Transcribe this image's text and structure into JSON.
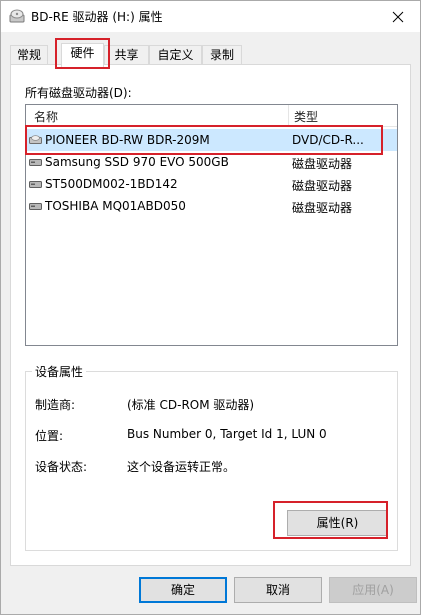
{
  "window": {
    "title": "BD-RE 驱动器 (H:) 属性",
    "title_icon": "optical-drive-icon",
    "close_icon": "close-icon"
  },
  "tabs": [
    {
      "label": "常规",
      "active": false
    },
    {
      "label": "硬件",
      "active": true
    },
    {
      "label": "共享",
      "active": false
    },
    {
      "label": "自定义",
      "active": false
    },
    {
      "label": "录制",
      "active": false
    }
  ],
  "hardware": {
    "list_caption": "所有磁盘驱动器(D):",
    "columns": {
      "name": "名称",
      "type": "类型"
    },
    "devices": [
      {
        "name": "PIONEER BD-RW   BDR-209M",
        "type": "DVD/CD-R...",
        "selected": true,
        "icon": "optical-drive-icon"
      },
      {
        "name": "Samsung SSD 970 EVO 500GB",
        "type": "磁盘驱动器",
        "selected": false,
        "icon": "disk-drive-icon"
      },
      {
        "name": "ST500DM002-1BD142",
        "type": "磁盘驱动器",
        "selected": false,
        "icon": "disk-drive-icon"
      },
      {
        "name": "TOSHIBA MQ01ABD050",
        "type": "磁盘驱动器",
        "selected": false,
        "icon": "disk-drive-icon"
      }
    ],
    "device_properties": {
      "title": "设备属性",
      "manufacturer_label": "制造商:",
      "manufacturer_value": "(标准 CD-ROM 驱动器)",
      "location_label": "位置:",
      "location_value": "Bus Number 0, Target Id 1, LUN 0",
      "status_label": "设备状态:",
      "status_value": "这个设备运转正常。",
      "properties_button": "属性(R)"
    }
  },
  "footer": {
    "ok": "确定",
    "cancel": "取消",
    "apply": "应用(A)"
  },
  "colors": {
    "highlight_red": "#d6212a",
    "selection": "#cce8ff",
    "default_button_border": "#0078d7"
  }
}
